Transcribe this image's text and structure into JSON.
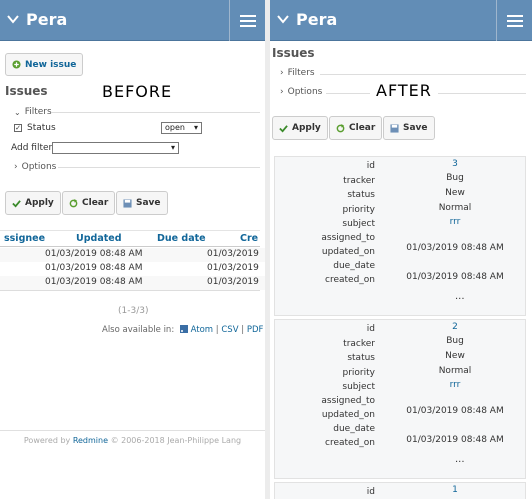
{
  "project_name": "Pera",
  "before_label": "BEFORE",
  "after_label": "AFTER",
  "left": {
    "new_issue": "New issue",
    "issues_title": "Issues",
    "filters_legend": "Filters",
    "status_label": "Status",
    "status_operator": "open",
    "add_filter_label": "Add filter",
    "add_filter_value": "",
    "options_legend": "Options",
    "apply": "Apply",
    "clear": "Clear",
    "save": "Save",
    "columns": [
      "ssignee",
      "Updated",
      "Due date",
      "Cre"
    ],
    "rows": [
      {
        "updated": "01/03/2019 08:48 AM",
        "created": "01/03/2019"
      },
      {
        "updated": "01/03/2019 08:48 AM",
        "created": "01/03/2019"
      },
      {
        "updated": "01/03/2019 08:48 AM",
        "created": "01/03/2019"
      }
    ],
    "pagination": "(1-3/3)",
    "also_available": "Also available in:",
    "formats": [
      "Atom",
      "CSV",
      "PDF"
    ],
    "footer_powered": "Powered by",
    "footer_link": "Redmine",
    "footer_copy": "© 2006-2018 Jean-Philippe Lang"
  },
  "right": {
    "issues_title": "Issues",
    "filters_legend": "Filters",
    "options_legend": "Options",
    "apply": "Apply",
    "clear": "Clear",
    "save": "Save",
    "field_labels": [
      "id",
      "tracker",
      "status",
      "priority",
      "subject",
      "assigned_to",
      "updated_on",
      "due_date",
      "created_on"
    ],
    "more": "...",
    "cards": [
      {
        "id": "3",
        "tracker": "Bug",
        "status": "New",
        "priority": "Normal",
        "subject": "rrr",
        "assigned_to": "",
        "updated_on": "01/03/2019 08:48 AM",
        "due_date": "",
        "created_on": "01/03/2019 08:48 AM"
      },
      {
        "id": "2",
        "tracker": "Bug",
        "status": "New",
        "priority": "Normal",
        "subject": "rrr",
        "assigned_to": "",
        "updated_on": "01/03/2019 08:48 AM",
        "due_date": "",
        "created_on": "01/03/2019 08:48 AM"
      },
      {
        "id": "1"
      }
    ]
  },
  "colors": {
    "header_bg": "#628db6",
    "link": "#169",
    "card_bg": "#f6f7f8"
  }
}
